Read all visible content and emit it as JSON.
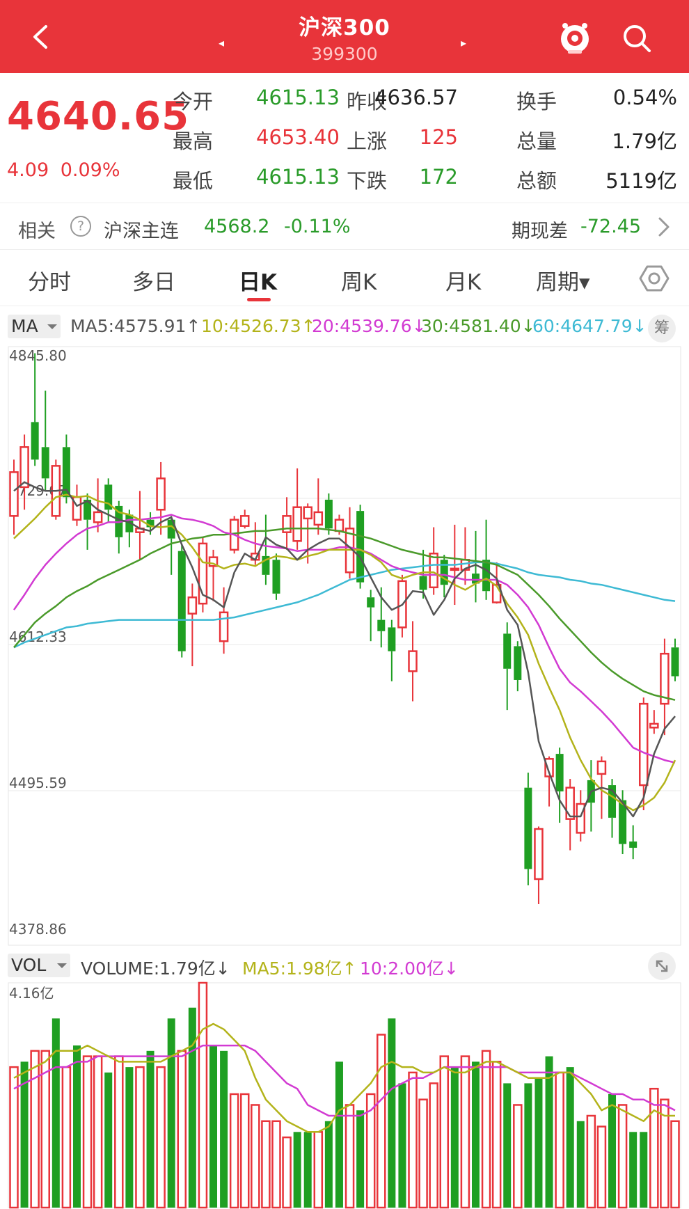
{
  "header": {
    "title": "沪深300",
    "code": "399300",
    "prev_label": "◂",
    "next_label": "▸"
  },
  "quote": {
    "price": "4640.65",
    "change": "4.09",
    "change_pct": "0.09%",
    "rows": [
      {
        "l1": "今开",
        "v1": "4615.13",
        "l2": "昨收",
        "v2": "4636.57",
        "l3": "换手",
        "v3": "0.54%"
      },
      {
        "l1": "最高",
        "v1": "4653.40",
        "l2": "上涨",
        "v2": "125",
        "l3": "总量",
        "v3": "1.79亿"
      },
      {
        "l1": "最低",
        "v1": "4615.13",
        "l2": "下跌",
        "v2": "172",
        "l3": "总额",
        "v3": "5119亿"
      }
    ]
  },
  "related": {
    "label": "相关",
    "help": "?",
    "name": "沪深主连",
    "price": "4568.2",
    "pct": "-0.11%",
    "basis_label": "期现差",
    "basis_value": "-72.45"
  },
  "tabs": [
    "分时",
    "多日",
    "日K",
    "周K",
    "月K",
    "周期▾"
  ],
  "active_tab": "日K",
  "ma_legend": {
    "selector": "MA",
    "ma5": "MA5:4575.91↑",
    "ma10": "10:4526.73↑",
    "ma20": "20:4539.76↓",
    "ma30": "30:4581.40↓",
    "ma60": "60:4647.79↓",
    "chip": "筹"
  },
  "vol_legend": {
    "selector": "VOL",
    "volume": "VOLUME:1.79亿↓",
    "ma5": "MA5:1.98亿↑",
    "ma10": "10:2.00亿↓"
  },
  "colors": {
    "up": "#e8343a",
    "down": "#1f9f22",
    "ma5": "#555555",
    "ma10": "#b3b31a",
    "ma20": "#d23ad2",
    "ma30": "#4a9a2a",
    "ma60": "#3ebad4"
  },
  "chart_data": [
    {
      "type": "candlestick",
      "y_ticks": [
        "4845.80",
        "4729.07",
        "4612.33",
        "4495.59",
        "4378.86"
      ],
      "ylim": [
        4378.86,
        4845.8
      ],
      "candles": [
        {
          "o": 4715,
          "c": 4750,
          "h": 4760,
          "l": 4700
        },
        {
          "o": 4738,
          "c": 4770,
          "h": 4780,
          "l": 4720
        },
        {
          "o": 4790,
          "c": 4760,
          "h": 4845,
          "l": 4755
        },
        {
          "o": 4770,
          "c": 4745,
          "h": 4815,
          "l": 4735
        },
        {
          "o": 4715,
          "c": 4755,
          "h": 4760,
          "l": 4712
        },
        {
          "o": 4770,
          "c": 4730,
          "h": 4780,
          "l": 4725
        },
        {
          "o": 4712,
          "c": 4730,
          "h": 4740,
          "l": 4707
        },
        {
          "o": 4728,
          "c": 4712,
          "h": 4733,
          "l": 4688
        },
        {
          "o": 4710,
          "c": 4718,
          "h": 4745,
          "l": 4702
        },
        {
          "o": 4740,
          "c": 4720,
          "h": 4745,
          "l": 4710
        },
        {
          "o": 4723,
          "c": 4698,
          "h": 4727,
          "l": 4685
        },
        {
          "o": 4716,
          "c": 4702,
          "h": 4720,
          "l": 4690
        },
        {
          "o": 4702,
          "c": 4705,
          "h": 4735,
          "l": 4680
        },
        {
          "o": 4712,
          "c": 4706,
          "h": 4718,
          "l": 4700
        },
        {
          "o": 4720,
          "c": 4745,
          "h": 4758,
          "l": 4700
        },
        {
          "o": 4712,
          "c": 4697,
          "h": 4715,
          "l": 4668
        },
        {
          "o": 4687,
          "c": 4607,
          "h": 4692,
          "l": 4602
        },
        {
          "o": 4637,
          "c": 4650,
          "h": 4661,
          "l": 4595
        },
        {
          "o": 4645,
          "c": 4693,
          "h": 4698,
          "l": 4638
        },
        {
          "o": 4675,
          "c": 4682,
          "h": 4688,
          "l": 4647
        },
        {
          "o": 4615,
          "c": 4638,
          "h": 4658,
          "l": 4605
        },
        {
          "o": 4688,
          "c": 4712,
          "h": 4715,
          "l": 4685
        },
        {
          "o": 4707,
          "c": 4715,
          "h": 4720,
          "l": 4705
        },
        {
          "o": 4680,
          "c": 4685,
          "h": 4710,
          "l": 4676
        },
        {
          "o": 4683,
          "c": 4668,
          "h": 4716,
          "l": 4660
        },
        {
          "o": 4680,
          "c": 4653,
          "h": 4685,
          "l": 4648
        },
        {
          "o": 4702,
          "c": 4715,
          "h": 4730,
          "l": 4688
        },
        {
          "o": 4695,
          "c": 4722,
          "h": 4753,
          "l": 4688
        },
        {
          "o": 4713,
          "c": 4722,
          "h": 4725,
          "l": 4677
        },
        {
          "o": 4708,
          "c": 4718,
          "h": 4745,
          "l": 4700
        },
        {
          "o": 4728,
          "c": 4705,
          "h": 4733,
          "l": 4700
        },
        {
          "o": 4703,
          "c": 4712,
          "h": 4716,
          "l": 4700
        },
        {
          "o": 4670,
          "c": 4705,
          "h": 4722,
          "l": 4665
        },
        {
          "o": 4719,
          "c": 4662,
          "h": 4724,
          "l": 4657
        },
        {
          "o": 4650,
          "c": 4642,
          "h": 4656,
          "l": 4615
        },
        {
          "o": 4632,
          "c": 4623,
          "h": 4658,
          "l": 4610
        },
        {
          "o": 4626,
          "c": 4607,
          "h": 4632,
          "l": 4583
        },
        {
          "o": 4626,
          "c": 4663,
          "h": 4668,
          "l": 4618
        },
        {
          "o": 4591,
          "c": 4607,
          "h": 4631,
          "l": 4567
        },
        {
          "o": 4667,
          "c": 4656,
          "h": 4688,
          "l": 4649
        },
        {
          "o": 4658,
          "c": 4685,
          "h": 4706,
          "l": 4652
        },
        {
          "o": 4680,
          "c": 4660,
          "h": 4684,
          "l": 4650
        },
        {
          "o": 4672,
          "c": 4673,
          "h": 4708,
          "l": 4644
        },
        {
          "o": 4672,
          "c": 4680,
          "h": 4706,
          "l": 4660
        },
        {
          "o": 4669,
          "c": 4661,
          "h": 4703,
          "l": 4646
        },
        {
          "o": 4680,
          "c": 4655,
          "h": 4712,
          "l": 4648
        },
        {
          "o": 4646,
          "c": 4660,
          "h": 4678,
          "l": 4645
        },
        {
          "o": 4621,
          "c": 4593,
          "h": 4630,
          "l": 4560
        },
        {
          "o": 4611,
          "c": 4584,
          "h": 4615,
          "l": 4575
        },
        {
          "o": 4498,
          "c": 4433,
          "h": 4510,
          "l": 4420
        },
        {
          "o": 4425,
          "c": 4465,
          "h": 4467,
          "l": 4405
        },
        {
          "o": 4507,
          "c": 4521,
          "h": 4523,
          "l": 4483
        },
        {
          "o": 4525,
          "c": 4495,
          "h": 4530,
          "l": 4470
        },
        {
          "o": 4473,
          "c": 4498,
          "h": 4505,
          "l": 4448
        },
        {
          "o": 4462,
          "c": 4485,
          "h": 4496,
          "l": 4455
        },
        {
          "o": 4504,
          "c": 4486,
          "h": 4520,
          "l": 4463
        },
        {
          "o": 4509,
          "c": 4519,
          "h": 4523,
          "l": 4473
        },
        {
          "o": 4500,
          "c": 4474,
          "h": 4505,
          "l": 4458
        },
        {
          "o": 4488,
          "c": 4453,
          "h": 4496,
          "l": 4445
        },
        {
          "o": 4455,
          "c": 4450,
          "h": 4468,
          "l": 4441
        },
        {
          "o": 4500,
          "c": 4565,
          "h": 4570,
          "l": 4480
        },
        {
          "o": 4546,
          "c": 4549,
          "h": 4560,
          "l": 4541
        },
        {
          "o": 4565,
          "c": 4605,
          "h": 4617,
          "l": 4540
        },
        {
          "o": 4610,
          "c": 4587,
          "h": 4617,
          "l": 4583
        }
      ],
      "ma5": [
        4735,
        4742,
        4738,
        4735,
        4735,
        4736,
        4723,
        4727,
        4720,
        4716,
        4712,
        4710,
        4705,
        4703,
        4710,
        4714,
        4692,
        4674,
        4652,
        4648,
        4642,
        4670,
        4685,
        4680,
        4698,
        4692,
        4689,
        4680,
        4688,
        4693,
        4697,
        4697,
        4690,
        4682,
        4666,
        4650,
        4640,
        4644,
        4655,
        4654,
        4636,
        4648,
        4665,
        4673,
        4676,
        4672,
        4665,
        4640,
        4628,
        4590,
        4535,
        4510,
        4488,
        4475,
        4475,
        4495,
        4498,
        4496,
        4486,
        4475,
        4490,
        4525,
        4545,
        4555
      ],
      "ma10": [
        4697,
        4705,
        4713,
        4722,
        4730,
        4732,
        4730,
        4731,
        4727,
        4725,
        4718,
        4716,
        4712,
        4707,
        4706,
        4707,
        4700,
        4690,
        4678,
        4677,
        4673,
        4676,
        4677,
        4675,
        4680,
        4683,
        4682,
        4680,
        4683,
        4685,
        4688,
        4688,
        4688,
        4688,
        4684,
        4678,
        4668,
        4665,
        4668,
        4670,
        4670,
        4665,
        4660,
        4656,
        4661,
        4665,
        4659,
        4645,
        4634,
        4620,
        4597,
        4578,
        4560,
        4538,
        4520,
        4505,
        4496,
        4491,
        4485,
        4480,
        4484,
        4490,
        4502,
        4520
      ],
      "ma20": [
        4640,
        4652,
        4665,
        4676,
        4685,
        4693,
        4700,
        4705,
        4707,
        4710,
        4710,
        4712,
        4712,
        4713,
        4714,
        4716,
        4713,
        4712,
        4710,
        4707,
        4702,
        4700,
        4696,
        4693,
        4691,
        4690,
        4689,
        4687,
        4688,
        4688,
        4688,
        4690,
        4690,
        4688,
        4685,
        4680,
        4675,
        4672,
        4670,
        4668,
        4668,
        4668,
        4666,
        4664,
        4664,
        4664,
        4664,
        4660,
        4652,
        4642,
        4628,
        4610,
        4593,
        4582,
        4575,
        4567,
        4559,
        4550,
        4540,
        4530,
        4526,
        4523,
        4520,
        4518
      ],
      "ma30": [
        4610,
        4620,
        4630,
        4637,
        4643,
        4650,
        4655,
        4659,
        4664,
        4668,
        4672,
        4676,
        4680,
        4685,
        4689,
        4693,
        4695,
        4697,
        4698,
        4700,
        4700,
        4701,
        4702,
        4703,
        4703,
        4704,
        4705,
        4705,
        4705,
        4705,
        4704,
        4703,
        4701,
        4699,
        4697,
        4694,
        4691,
        4688,
        4686,
        4684,
        4682,
        4682,
        4681,
        4680,
        4679,
        4678,
        4676,
        4672,
        4668,
        4660,
        4652,
        4643,
        4633,
        4624,
        4615,
        4606,
        4598,
        4591,
        4585,
        4580,
        4575,
        4572,
        4570,
        4568
      ],
      "ma60": [
        4610,
        4614,
        4617,
        4620,
        4623,
        4626,
        4627,
        4629,
        4630,
        4631,
        4632,
        4632,
        4632,
        4632,
        4632,
        4632,
        4632,
        4632,
        4632,
        4632,
        4633,
        4634,
        4636,
        4638,
        4640,
        4642,
        4644,
        4646,
        4649,
        4652,
        4656,
        4660,
        4664,
        4666,
        4668,
        4670,
        4672,
        4673,
        4674,
        4675,
        4676,
        4676,
        4676,
        4677,
        4678,
        4678,
        4677,
        4675,
        4673,
        4670,
        4668,
        4667,
        4666,
        4664,
        4663,
        4661,
        4660,
        4658,
        4656,
        4654,
        4652,
        4650,
        4648,
        4647
      ]
    },
    {
      "type": "bar",
      "y_ticks": [
        "4.16亿"
      ],
      "ylim": [
        0,
        4.16
      ],
      "volumes": [
        {
          "v": 2.6,
          "up": true
        },
        {
          "v": 2.7,
          "up": false
        },
        {
          "v": 2.9,
          "up": true
        },
        {
          "v": 2.9,
          "up": true
        },
        {
          "v": 3.5,
          "up": false
        },
        {
          "v": 2.6,
          "up": true
        },
        {
          "v": 3.0,
          "up": false
        },
        {
          "v": 2.8,
          "up": true
        },
        {
          "v": 2.8,
          "up": true
        },
        {
          "v": 2.5,
          "up": false
        },
        {
          "v": 2.8,
          "up": true
        },
        {
          "v": 2.6,
          "up": false
        },
        {
          "v": 2.6,
          "up": true
        },
        {
          "v": 2.9,
          "up": false
        },
        {
          "v": 2.6,
          "up": true
        },
        {
          "v": 3.5,
          "up": false
        },
        {
          "v": 2.9,
          "up": true
        },
        {
          "v": 3.7,
          "up": false
        },
        {
          "v": 4.16,
          "up": true
        },
        {
          "v": 3.0,
          "up": false
        },
        {
          "v": 2.9,
          "up": false
        },
        {
          "v": 2.1,
          "up": true
        },
        {
          "v": 2.1,
          "up": true
        },
        {
          "v": 1.9,
          "up": true
        },
        {
          "v": 1.6,
          "up": true
        },
        {
          "v": 1.6,
          "up": true
        },
        {
          "v": 1.3,
          "up": true
        },
        {
          "v": 1.4,
          "up": false
        },
        {
          "v": 1.4,
          "up": false
        },
        {
          "v": 1.4,
          "up": true
        },
        {
          "v": 1.6,
          "up": false
        },
        {
          "v": 2.7,
          "up": false
        },
        {
          "v": 1.9,
          "up": true
        },
        {
          "v": 1.8,
          "up": false
        },
        {
          "v": 2.1,
          "up": true
        },
        {
          "v": 3.2,
          "up": true
        },
        {
          "v": 3.5,
          "up": false
        },
        {
          "v": 2.3,
          "up": false
        },
        {
          "v": 2.5,
          "up": true
        },
        {
          "v": 2.0,
          "up": true
        },
        {
          "v": 2.3,
          "up": true
        },
        {
          "v": 2.8,
          "up": true
        },
        {
          "v": 2.6,
          "up": false
        },
        {
          "v": 2.8,
          "up": true
        },
        {
          "v": 2.7,
          "up": false
        },
        {
          "v": 2.9,
          "up": true
        },
        {
          "v": 2.7,
          "up": true
        },
        {
          "v": 2.3,
          "up": false
        },
        {
          "v": 1.9,
          "up": true
        },
        {
          "v": 2.3,
          "up": false
        },
        {
          "v": 2.4,
          "up": false
        },
        {
          "v": 2.8,
          "up": false
        },
        {
          "v": 2.5,
          "up": true
        },
        {
          "v": 2.6,
          "up": false
        },
        {
          "v": 1.6,
          "up": false
        },
        {
          "v": 1.7,
          "up": true
        },
        {
          "v": 1.5,
          "up": true
        },
        {
          "v": 2.1,
          "up": false
        },
        {
          "v": 1.9,
          "up": true
        },
        {
          "v": 1.4,
          "up": false
        },
        {
          "v": 1.4,
          "up": false
        },
        {
          "v": 2.2,
          "up": true
        },
        {
          "v": 2.0,
          "up": true
        },
        {
          "v": 1.6,
          "up": true
        }
      ],
      "ma5": [
        2.4,
        2.5,
        2.6,
        2.7,
        2.9,
        2.9,
        2.9,
        3.0,
        2.9,
        2.8,
        2.7,
        2.7,
        2.7,
        2.7,
        2.7,
        2.8,
        2.9,
        3.0,
        3.3,
        3.4,
        3.3,
        3.1,
        2.9,
        2.4,
        2.0,
        1.8,
        1.6,
        1.5,
        1.4,
        1.4,
        1.5,
        1.8,
        1.9,
        2.1,
        2.3,
        2.6,
        2.7,
        2.6,
        2.6,
        2.5,
        2.5,
        2.6,
        2.5,
        2.5,
        2.6,
        2.7,
        2.7,
        2.6,
        2.5,
        2.4,
        2.4,
        2.4,
        2.5,
        2.5,
        2.3,
        2.1,
        1.8,
        1.9,
        1.8,
        1.7,
        1.6,
        1.8,
        1.7,
        1.7
      ],
      "ma10": [
        2.2,
        2.3,
        2.4,
        2.5,
        2.6,
        2.6,
        2.7,
        2.7,
        2.8,
        2.8,
        2.8,
        2.8,
        2.8,
        2.8,
        2.8,
        2.8,
        2.8,
        2.9,
        3.0,
        3.0,
        3.0,
        3.0,
        3.0,
        2.9,
        2.7,
        2.5,
        2.3,
        2.2,
        1.9,
        1.8,
        1.7,
        1.7,
        1.7,
        1.7,
        1.8,
        2.0,
        2.2,
        2.3,
        2.4,
        2.4,
        2.5,
        2.6,
        2.6,
        2.6,
        2.6,
        2.6,
        2.6,
        2.6,
        2.5,
        2.5,
        2.5,
        2.5,
        2.5,
        2.5,
        2.4,
        2.3,
        2.2,
        2.1,
        2.1,
        2.0,
        2.0,
        1.9,
        1.9,
        1.8
      ]
    }
  ]
}
